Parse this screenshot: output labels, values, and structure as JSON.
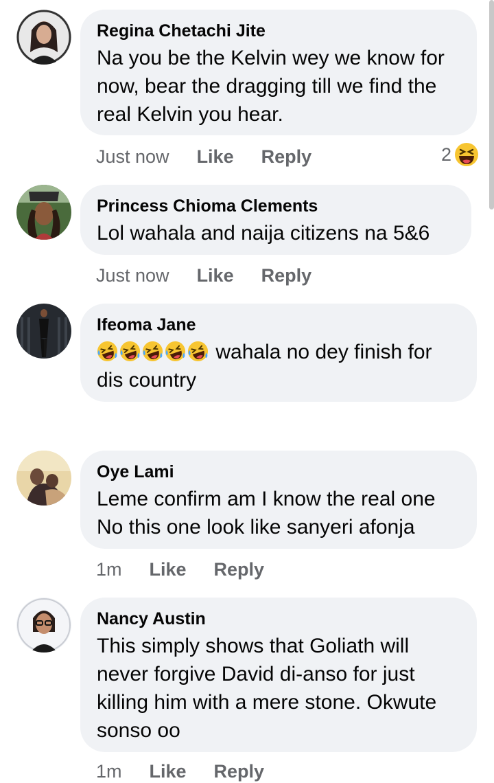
{
  "comments": [
    {
      "author": "Regina Chetachi Jite",
      "text": "Na you be the Kelvin wey we know for now, bear the dragging till we find the real Kelvin you hear.",
      "time": "Just now",
      "like": "Like",
      "reply": "Reply",
      "reaction_count": "2",
      "reaction_icon": "laughing-emoji-icon"
    },
    {
      "author": "Princess Chioma Clements",
      "text": "Lol wahala and naija citizens na 5&6",
      "time": "Just now",
      "like": "Like",
      "reply": "Reply"
    },
    {
      "author": "Ifeoma Jane",
      "text": "wahala no dey finish for dis country",
      "emoji_prefix_count": 5,
      "emoji_icon": "rolling-laughing-emoji-icon"
    },
    {
      "author": "Oye Lami",
      "text": "Leme confirm am I know the real one No this one look like sanyeri afonja",
      "time": "1m",
      "like": "Like",
      "reply": "Reply"
    },
    {
      "author": "Nancy Austin",
      "text": "This simply shows that Goliath will never forgive David di-anso for just killing him with a mere stone. Okwute sonso oo",
      "time": "1m",
      "like": "Like",
      "reply": "Reply"
    }
  ],
  "colors": {
    "bubble": "#f0f2f5",
    "meta": "#65676b",
    "text": "#050505"
  }
}
